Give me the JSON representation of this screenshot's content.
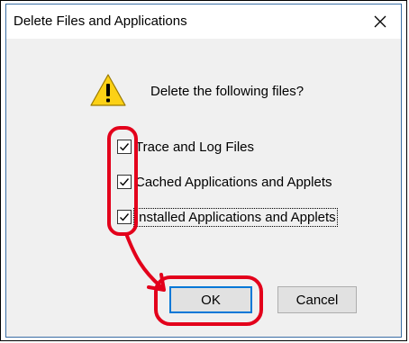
{
  "dialog": {
    "title": "Delete Files and Applications",
    "prompt": "Delete the following files?",
    "icons": {
      "warning": "warning-icon",
      "close": "close-icon"
    },
    "options": [
      {
        "label": "Trace and Log Files",
        "checked": true
      },
      {
        "label": "Cached Applications and Applets",
        "checked": true
      },
      {
        "label": "Installed Applications and Applets",
        "checked": true
      }
    ],
    "buttons": {
      "ok": "OK",
      "cancel": "Cancel"
    }
  },
  "annotation": {
    "color": "#e3001b"
  }
}
